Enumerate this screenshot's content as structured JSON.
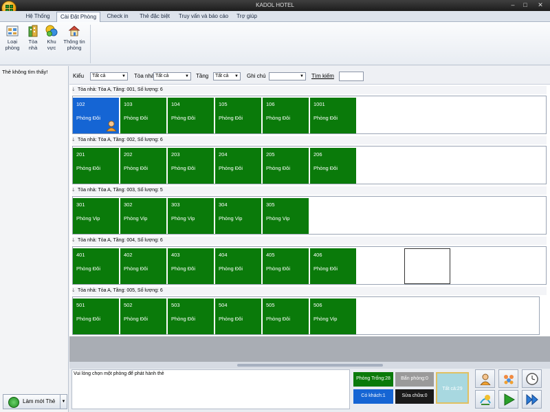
{
  "window": {
    "title": "KADOL HOTEL"
  },
  "tabs": [
    {
      "label": "Hệ Thống"
    },
    {
      "label": "Cài Đặt Phòng"
    },
    {
      "label": "Check in"
    },
    {
      "label": "Thẻ đặc biệt"
    },
    {
      "label": "Truy vấn và báo cáo"
    },
    {
      "label": "Trợ giúp"
    }
  ],
  "ribbon": {
    "buttons": [
      {
        "line1": "Loại",
        "line2": "phòng",
        "icon": "room-type-icon"
      },
      {
        "line1": "Tòa",
        "line2": "nhà",
        "icon": "building-icon"
      },
      {
        "line1": "Khu",
        "line2": "vực",
        "icon": "area-icon"
      },
      {
        "line1": "Thông tin",
        "line2": "phòng",
        "icon": "room-info-icon"
      }
    ]
  },
  "left_pane": {
    "message": "Thẻ không tìm thấy!",
    "refresh_button": "Làm mới Thẻ"
  },
  "filters": {
    "kieu_label": "Kiểu",
    "kieu_value": "Tất cả",
    "toanha_label": "Tòa nhà",
    "toanha_value": "Tất cả",
    "tang_label": "Tầng",
    "tang_value": "Tất cả",
    "ghichu_label": "Ghi chú",
    "ghichu_value": "",
    "timkiem_label": "Tìm kiếm",
    "timkiem_value": ""
  },
  "groups": [
    {
      "header": "Tòa nhà: Tòa A, Tầng: 001, Số lượng: 6",
      "rooms": [
        {
          "number": "102",
          "type": "Phòng Đôi",
          "selected": true,
          "occupied": true
        },
        {
          "number": "103",
          "type": "Phòng Đôi"
        },
        {
          "number": "104",
          "type": "Phòng Đôi"
        },
        {
          "number": "105",
          "type": "Phòng Đôi"
        },
        {
          "number": "106",
          "type": "Phòng Đôi"
        },
        {
          "number": "1001",
          "type": "Phòng Đôi"
        }
      ]
    },
    {
      "header": "Tòa nhà: Tòa A, Tầng: 002, Số lượng: 6",
      "rooms": [
        {
          "number": "201",
          "type": "Phòng Đôi"
        },
        {
          "number": "202",
          "type": "Phòng Đôi"
        },
        {
          "number": "203",
          "type": "Phòng Đôi"
        },
        {
          "number": "204",
          "type": "Phòng Đôi"
        },
        {
          "number": "205",
          "type": "Phòng Đôi"
        },
        {
          "number": "206",
          "type": "Phòng Đôi"
        }
      ]
    },
    {
      "header": "Tòa nhà: Tòa A, Tầng: 003, Số lượng: 5",
      "rooms": [
        {
          "number": "301",
          "type": "Phòng Vip"
        },
        {
          "number": "302",
          "type": "Phòng Vip"
        },
        {
          "number": "303",
          "type": "Phòng Vip"
        },
        {
          "number": "304",
          "type": "Phòng Vip"
        },
        {
          "number": "305",
          "type": "Phòng Vip"
        }
      ]
    },
    {
      "header": "Tòa nhà: Tòa A, Tầng: 004, Số lượng: 6",
      "rooms": [
        {
          "number": "401",
          "type": "Phòng Đôi"
        },
        {
          "number": "402",
          "type": "Phòng Đôi"
        },
        {
          "number": "403",
          "type": "Phòng Đôi"
        },
        {
          "number": "404",
          "type": "Phòng Đôi"
        },
        {
          "number": "405",
          "type": "Phòng Đôi"
        },
        {
          "number": "406",
          "type": "Phòng Đôi"
        }
      ],
      "empty_slot": true
    },
    {
      "header": "Tòa nhà: Tòa A, Tầng: 005, Số lượng: 6",
      "rooms": [
        {
          "number": "501",
          "type": "Phòng Đôi"
        },
        {
          "number": "502",
          "type": "Phòng Đôi"
        },
        {
          "number": "503",
          "type": "Phòng Đôi"
        },
        {
          "number": "504",
          "type": "Phòng Đôi"
        },
        {
          "number": "505",
          "type": "Phòng Đôi"
        },
        {
          "number": "506",
          "type": "Phòng Vip"
        }
      ]
    }
  ],
  "bottom": {
    "message": "Vui lòng chọn một phòng để phát hành thẻ"
  },
  "status": {
    "phong_trong": "Phòng Trống:28",
    "ban_phong": "Bẩn phòng:0",
    "co_khach": "Có khách:1",
    "sua_chua": "Sửa chữa:0",
    "tat_ca": "Tất cả:29"
  },
  "colors": {
    "room_available": "#0a7a0a",
    "room_selected": "#1565d4",
    "status_empty": "#0a7a0a",
    "status_dirty": "#9a9a9a",
    "status_guest": "#1565d4",
    "status_repair": "#1a1a1a",
    "status_all": "#a8d8e0"
  },
  "actions": [
    "guest-icon",
    "group-guests-icon",
    "clock-icon",
    "checkout-icon",
    "play-icon",
    "fast-forward-icon"
  ]
}
